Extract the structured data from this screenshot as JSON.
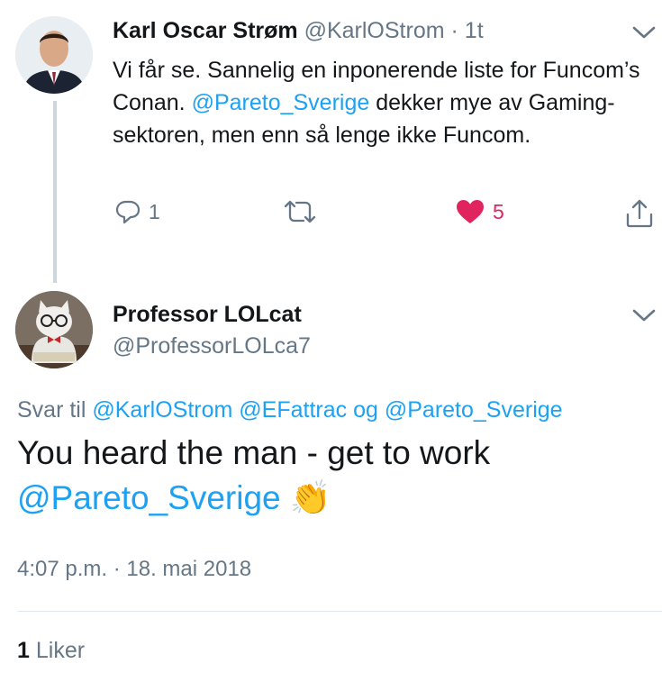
{
  "tweet1": {
    "name": "Karl Oscar Strøm",
    "handle": "@KarlOStrom",
    "sep": "·",
    "time": "1t",
    "text_parts": [
      "Vi får se. Sannelig en inponerende liste for Funcom’s Conan. ",
      "@Pareto_Sverige",
      " dekker mye av Gaming-sektoren, men enn så lenge ikke Funcom."
    ],
    "reply_count": "1",
    "like_count": "5",
    "icons": [
      "reply-icon",
      "retweet-icon",
      "heart-icon",
      "share-icon",
      "chevron-down-icon"
    ]
  },
  "tweet2": {
    "name": "Professor LOLcat",
    "handle": "@ProfessorLOLca7",
    "reply_label": "Svar til",
    "mention1": "@KarlOStrom",
    "mention2": "@EFattrac",
    "conj": "og",
    "mention3": "@Pareto_Sverige",
    "text_line1": "You heard the man - get to work",
    "text_mention": "@Pareto_Sverige",
    "emoji": "👏",
    "timestamp": "4:07 p.m. · 18. mai 2018",
    "likes_count": "1",
    "likes_label": "Liker"
  },
  "colors": {
    "link": "#1da1f2",
    "muted": "#657786",
    "like": "#e0245e",
    "thread_line": "#ccd6dd"
  }
}
